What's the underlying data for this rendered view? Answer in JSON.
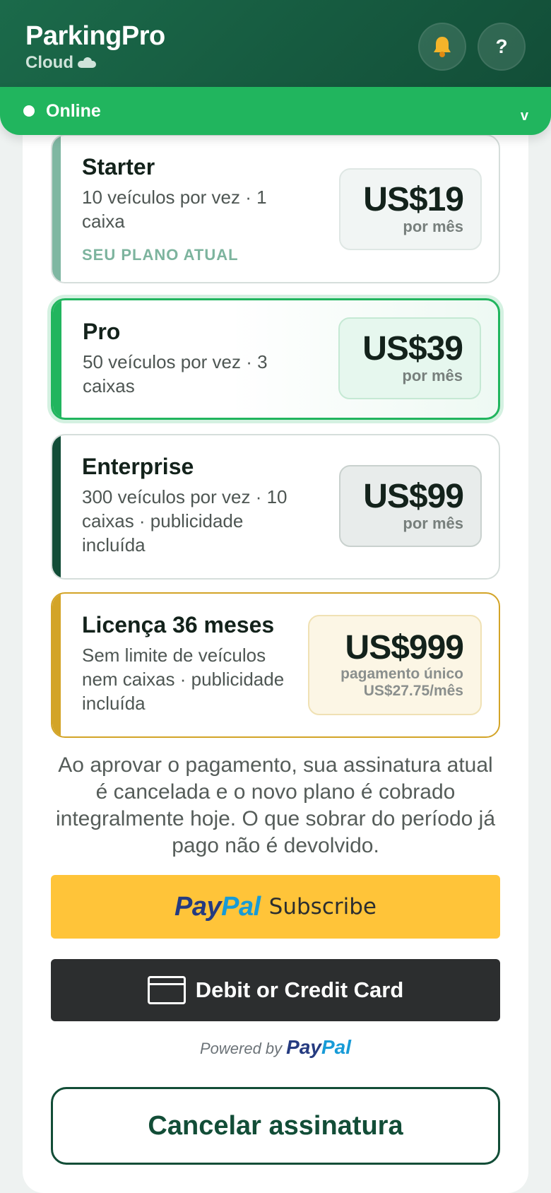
{
  "header": {
    "brand": "ParkingPro",
    "subtitle": "Cloud",
    "bell_icon": "bell-icon",
    "help_label": "?"
  },
  "status": {
    "label": "Online",
    "chevron": "v"
  },
  "plans": [
    {
      "name": "Starter",
      "description": "10 veículos por vez · 1 caixa",
      "badge": "SEU PLANO ATUAL",
      "price": "US$19",
      "period": "por mês",
      "accent": "#7fb7a2"
    },
    {
      "name": "Pro",
      "description": "50 veículos por vez · 3 caixas",
      "price": "US$39",
      "period": "por mês",
      "accent": "#21b55e"
    },
    {
      "name": "Enterprise",
      "description": "300 veículos por vez · 10 caixas · publicidade incluída",
      "price": "US$99",
      "period": "por mês",
      "accent": "#124d37"
    },
    {
      "name": "Licença 36 meses",
      "description": "Sem limite de veículos nem caixas · publicidade incluída",
      "price": "US$999",
      "period": "pagamento único",
      "monthly": "US$27.75/mês",
      "accent": "#d3a427"
    }
  ],
  "notice": "Ao aprovar o pagamento, sua assinatura atual é cancelada e o novo plano é cobrado integralmente hoje. O que sobrar do período já pago não é devolvido.",
  "paypal": {
    "logo_a": "Pay",
    "logo_b": "Pal",
    "subscribe": "Subscribe",
    "card_label": "Debit or Credit Card",
    "powered_by": "Powered by"
  },
  "cancel_label": "Cancelar assinatura",
  "colors": {
    "brand_dark": "#124d37",
    "online_green": "#21b55e",
    "paypal_yellow": "#ffc439"
  }
}
